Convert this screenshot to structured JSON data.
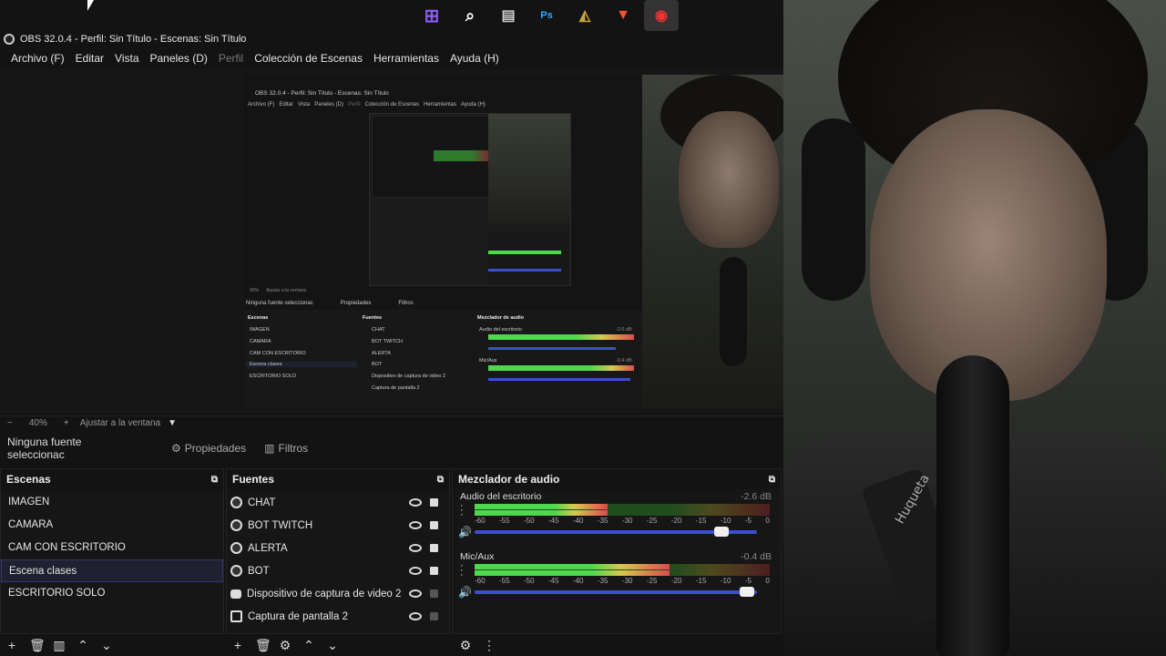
{
  "window": {
    "title": "OBS 32.0.4 - Perfil: Sin Título - Escenas: Sin Título"
  },
  "taskbar": {
    "icons": [
      "windows-icon",
      "search-icon",
      "files-icon",
      "photoshop-icon",
      "lol-icon",
      "brave-icon",
      "obs-icon"
    ],
    "ps_label": "Ps"
  },
  "menu": [
    {
      "label": "Archivo (F)"
    },
    {
      "label": "Editar"
    },
    {
      "label": "Vista"
    },
    {
      "label": "Paneles (D)"
    },
    {
      "label": "Perfil",
      "disabled": true
    },
    {
      "label": "Colección de Escenas"
    },
    {
      "label": "Herramientas"
    },
    {
      "label": "Ayuda (H)"
    }
  ],
  "zoom": {
    "minus": "−",
    "value": "40%",
    "plus": "+",
    "fit": "Ajustar a la ventana"
  },
  "propbar": {
    "no_source": "Ninguna fuente seleccionac",
    "properties": "Propiedades",
    "filters": "Filtros"
  },
  "scenes": {
    "title": "Escenas",
    "items": [
      "IMAGEN",
      "CAMARA",
      "CAM CON ESCRITORIO",
      "Escena clases",
      "ESCRITORIO SOLO"
    ],
    "selected": "Escena clases"
  },
  "sources": {
    "title": "Fuentes",
    "items": [
      {
        "label": "CHAT",
        "icon": "browser-icon",
        "locked": true
      },
      {
        "label": "BOT TWITCH",
        "icon": "browser-icon",
        "locked": true
      },
      {
        "label": "ALERTA",
        "icon": "browser-icon",
        "locked": true
      },
      {
        "label": "BOT",
        "icon": "browser-icon",
        "locked": true
      },
      {
        "label": "Dispositivo de captura de video 2",
        "icon": "camera-icon",
        "locked": false
      },
      {
        "label": "Captura de pantalla 2",
        "icon": "monitor-icon",
        "locked": false
      }
    ]
  },
  "mixer": {
    "title": "Mezclador de audio",
    "channels": [
      {
        "name": "Audio del escritorio",
        "db": "-2.6 dB",
        "level": 0.45,
        "fader": 0.9
      },
      {
        "name": "Mic/Aux",
        "db": "-0.4 dB",
        "level": 0.66,
        "fader": 0.99
      }
    ],
    "ticks": [
      "-60",
      "-55",
      "-50",
      "-45",
      "-40",
      "-35",
      "-30",
      "-25",
      "-20",
      "-15",
      "-10",
      "-5",
      "0"
    ]
  },
  "nested_preview": {
    "title": "OBS 32.0.4 - Perfil: Sin Título - Escenas: Sin Título",
    "menu": [
      "Archivo (F)",
      "Editar",
      "Vista",
      "Paneles (D)",
      "Perfil",
      "Colección de Escenas",
      "Herramientas",
      "Ayuda (H)"
    ],
    "zoom": "40%",
    "fit": "Ajustar a la ventana",
    "no_source": "Ninguna fuente seleccionac",
    "properties": "Propiedades",
    "filters": "Filtros",
    "scenes_title": "Escenas",
    "sources_title": "Fuentes",
    "mixer_title": "Mezclador de audio",
    "scenes": [
      "IMAGEN",
      "CAMARA",
      "CAM CON ESCRITORIO",
      "Escena clases",
      "ESCRITORIO SOLO"
    ],
    "sources": [
      "CHAT",
      "BOT TWITCH",
      "ALERTA",
      "BOT",
      "Dispositivo de captura de video 2",
      "Captura de pantalla 2"
    ],
    "mixer_ch1": "Audio del escritorio",
    "mixer_ch1_db": "-2.6 dB",
    "mixer_ch2": "Mic/Aux",
    "mixer_ch2_db": "-0.4 dB"
  },
  "webcam": {
    "label": "webcam-feed",
    "strap_text": "Huqueta"
  },
  "colors": {
    "accent": "#3a4fcf",
    "selection": "#1f2130",
    "bg": "#131313"
  }
}
